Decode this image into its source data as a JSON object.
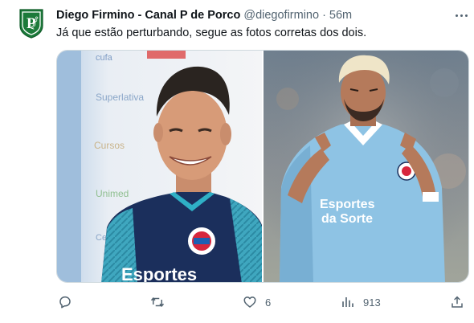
{
  "tweet": {
    "author_name": "Diego Firmino - Canal P de Porco",
    "handle": "@diegofirmino",
    "separator": "·",
    "time": "56m",
    "text": "Já que estão perturbando, segue as fotos corretas dos dois.",
    "avatar_logo_text": "Porco",
    "avatar_icon": "pig-shield-logo",
    "more_icon": "more-horizontal-icon"
  },
  "media": {
    "left_photo": {
      "subject": "smiling-player-navy-jersey",
      "shirt_text": "Esportes",
      "backdrop_texts": [
        "cufa",
        "Superlativa",
        "Cursos",
        "CenterCasa",
        "Unimed"
      ]
    },
    "right_photo": {
      "subject": "blond-player-light-blue-jersey-celebrating",
      "shirt_text_line1": "Esportes",
      "shirt_text_line2": "da Sorte"
    }
  },
  "actions": {
    "reply": {
      "icon": "reply-icon"
    },
    "retweet": {
      "icon": "retweet-icon"
    },
    "like": {
      "icon": "heart-icon",
      "count": "6"
    },
    "views": {
      "icon": "views-bar-chart-icon",
      "count": "913"
    },
    "share": {
      "icon": "share-icon"
    }
  },
  "colors": {
    "text_primary": "#0f1419",
    "text_secondary": "#536471",
    "border": "#cfd9de",
    "logo_green": "#1c7a3a",
    "bahia_light_blue": "#8ec3e4",
    "bahia_navy": "#1b2f5c"
  }
}
